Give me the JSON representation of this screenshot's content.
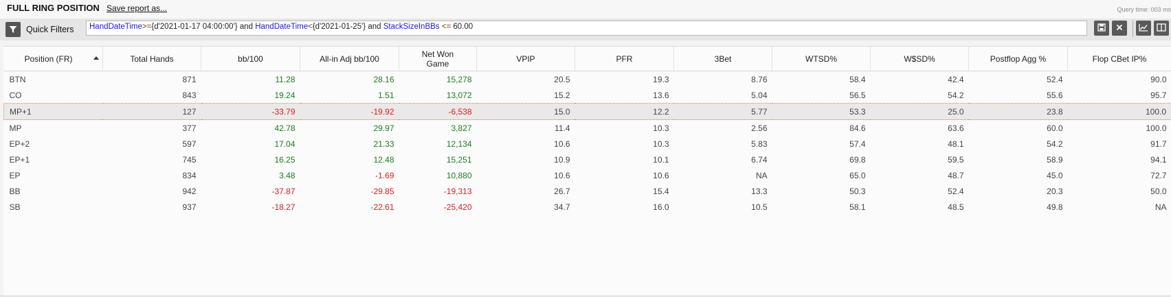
{
  "header": {
    "title": "FULL RING POSITION",
    "save_link": "Save report as...",
    "query_time": "Query time: 003 ms"
  },
  "filters": {
    "quick_filters_label": "Quick Filters",
    "funnel_icon": "funnel-icon",
    "expression": {
      "f1": "HandDateTime",
      "op1": ">=",
      "v1": "{d'2021-01-17 04:00:00'}",
      "and1": " and ",
      "f2": "HandDateTime",
      "op2": "<",
      "v2": "{d'2021-01-25'}",
      "and2": " and ",
      "f3": "StackSizeInBBs",
      "op3": " <= ",
      "v3": "60.00"
    },
    "buttons": [
      "save-icon",
      "close-icon",
      "chart-icon",
      "split-view-icon"
    ]
  },
  "table": {
    "columns": [
      "Position (FR)",
      "Total Hands",
      "bb/100",
      "All-in Adj bb/100",
      "Net Won Game",
      "VPIP",
      "PFR",
      "3Bet",
      "WTSD%",
      "W$SD%",
      "Postflop Agg %",
      "Flop CBet IP%"
    ],
    "net_won_line1": "Net Won",
    "net_won_line2": "Game",
    "rows": [
      {
        "pos": "BTN",
        "hands": "871",
        "bb": "11.28",
        "allin": "28.16",
        "net": "15,278",
        "vpip": "20.5",
        "pfr": "19.3",
        "tbet": "8.76",
        "wtsd": "58.4",
        "wsd": "42.4",
        "agg": "52.4",
        "cbet": "90.0"
      },
      {
        "pos": "CO",
        "hands": "843",
        "bb": "19.24",
        "allin": "1.51",
        "net": "13,072",
        "vpip": "15.2",
        "pfr": "13.6",
        "tbet": "5.04",
        "wtsd": "56.5",
        "wsd": "54.2",
        "agg": "55.6",
        "cbet": "95.7"
      },
      {
        "pos": "MP+1",
        "hands": "127",
        "bb": "-33.79",
        "allin": "-19.92",
        "net": "-6,538",
        "vpip": "15.0",
        "pfr": "12.2",
        "tbet": "5.77",
        "wtsd": "53.3",
        "wsd": "25.0",
        "agg": "23.8",
        "cbet": "100.0"
      },
      {
        "pos": "MP",
        "hands": "377",
        "bb": "42.78",
        "allin": "29.97",
        "net": "3,827",
        "vpip": "11.4",
        "pfr": "10.3",
        "tbet": "2.56",
        "wtsd": "84.6",
        "wsd": "63.6",
        "agg": "60.0",
        "cbet": "100.0"
      },
      {
        "pos": "EP+2",
        "hands": "597",
        "bb": "17.04",
        "allin": "21.33",
        "net": "12,134",
        "vpip": "10.6",
        "pfr": "10.3",
        "tbet": "5.83",
        "wtsd": "57.4",
        "wsd": "48.1",
        "agg": "54.2",
        "cbet": "91.7"
      },
      {
        "pos": "EP+1",
        "hands": "745",
        "bb": "16.25",
        "allin": "12.48",
        "net": "15,251",
        "vpip": "10.9",
        "pfr": "10.1",
        "tbet": "6.74",
        "wtsd": "69.8",
        "wsd": "59.5",
        "agg": "58.9",
        "cbet": "94.1"
      },
      {
        "pos": "EP",
        "hands": "834",
        "bb": "3.48",
        "allin": "-1.69",
        "net": "10,880",
        "vpip": "10.6",
        "pfr": "10.6",
        "tbet": "NA",
        "wtsd": "65.0",
        "wsd": "48.7",
        "agg": "45.0",
        "cbet": "72.7"
      },
      {
        "pos": "BB",
        "hands": "942",
        "bb": "-37.87",
        "allin": "-29.85",
        "net": "-19,313",
        "vpip": "26.7",
        "pfr": "15.4",
        "tbet": "13.3",
        "wtsd": "50.3",
        "wsd": "52.4",
        "agg": "20.3",
        "cbet": "50.0"
      },
      {
        "pos": "SB",
        "hands": "937",
        "bb": "-18.27",
        "allin": "-22.61",
        "net": "-25,420",
        "vpip": "34.7",
        "pfr": "16.0",
        "tbet": "10.5",
        "wtsd": "58.1",
        "wsd": "48.5",
        "agg": "49.8",
        "cbet": "NA"
      }
    ],
    "selected_row": 2,
    "colors": {
      "positive": "#1e7b1e",
      "negative": "#d81e1e",
      "selection_border": "#d07a50"
    }
  }
}
